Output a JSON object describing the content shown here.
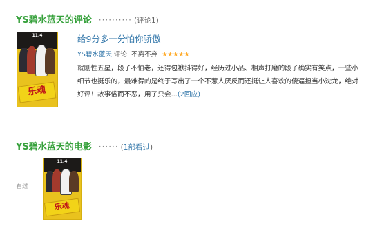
{
  "review_section": {
    "heading": "YS碧水蓝天的评论",
    "dots": "··········",
    "count_label": "(评论1)"
  },
  "review": {
    "title": "给9分多一分怕你骄傲",
    "author": "YS碧水蓝天",
    "rating_label": "评论: 不离不弃",
    "stars": "★★★★★",
    "body": "就刚性五星，段子不怕老，还得包袱抖得好，经历过小品、相声打磨的段子确实有笑点，一些小细节也挺乐的，最难得的是终于写出了一个不惹人厌反而还挺让人喜欢的傻逼担当小沈龙，绝对好评！故事俗而不恶，用了只会...",
    "reply_link": "(2回应)"
  },
  "poster": {
    "top_text": "11.4",
    "title_text": "乐魂"
  },
  "movie_section": {
    "heading": "YS碧水蓝天的电影",
    "dots": "······",
    "count_open": "(",
    "count_link": "1部看过",
    "count_close": ")"
  },
  "seen_label": "看过",
  "colors": {
    "heading_green": "#37a13c",
    "link_blue": "#3377aa",
    "star_orange": "#ffac2d",
    "poster_yellow": "#e9c21e"
  }
}
